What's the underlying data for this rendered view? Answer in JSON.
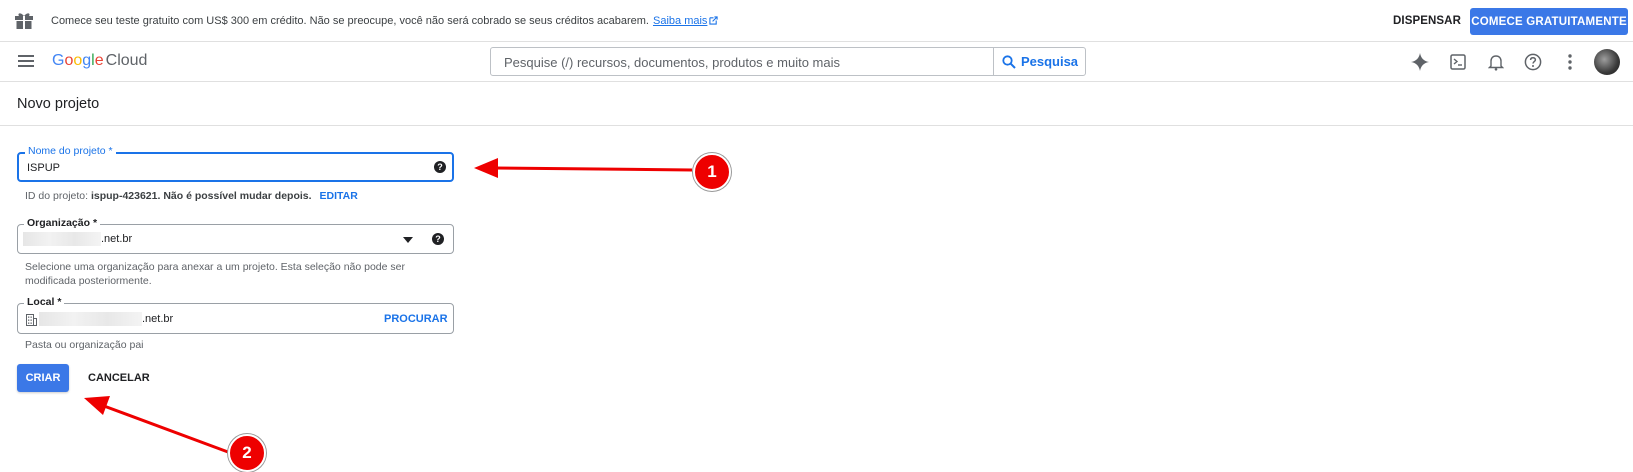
{
  "promo": {
    "text": "Comece seu teste gratuito com US$ 300 em crédito. Não se preocupe, você não será cobrado se seus créditos acabarem.",
    "link": "Saiba mais",
    "dismiss": "DISPENSAR",
    "start": "COMECE GRATUITAMENTE"
  },
  "header": {
    "logo_google": "Google",
    "logo_cloud": "Cloud",
    "search_placeholder": "Pesquise (/) recursos, documentos, produtos e muito mais",
    "search_button": "Pesquisa",
    "icons": [
      "gemini-sparkle-icon",
      "cloud-shell-icon",
      "notifications-bell-icon",
      "help-icon",
      "more-vert-icon"
    ]
  },
  "page": {
    "title": "Novo projeto"
  },
  "form": {
    "project_name": {
      "label": "Nome do projeto *",
      "value": "ISPUP",
      "hint_prefix": "ID do projeto: ",
      "hint_bold": "ispup-423621. Não é possível mudar depois.",
      "edit": "EDITAR"
    },
    "organization": {
      "label": "Organização *",
      "value_suffix": ".net.br",
      "hint_line1": "Selecione uma organização para anexar a um projeto. Esta seleção não pode ser",
      "hint_line2": "modificada posteriormente."
    },
    "location": {
      "label": "Local *",
      "value_suffix": ".net.br",
      "browse": "PROCURAR",
      "hint": "Pasta ou organização pai"
    },
    "create": "CRIAR",
    "cancel": "CANCELAR"
  },
  "annotations": {
    "badge_1": "1",
    "badge_2": "2",
    "color": "#e00000"
  }
}
